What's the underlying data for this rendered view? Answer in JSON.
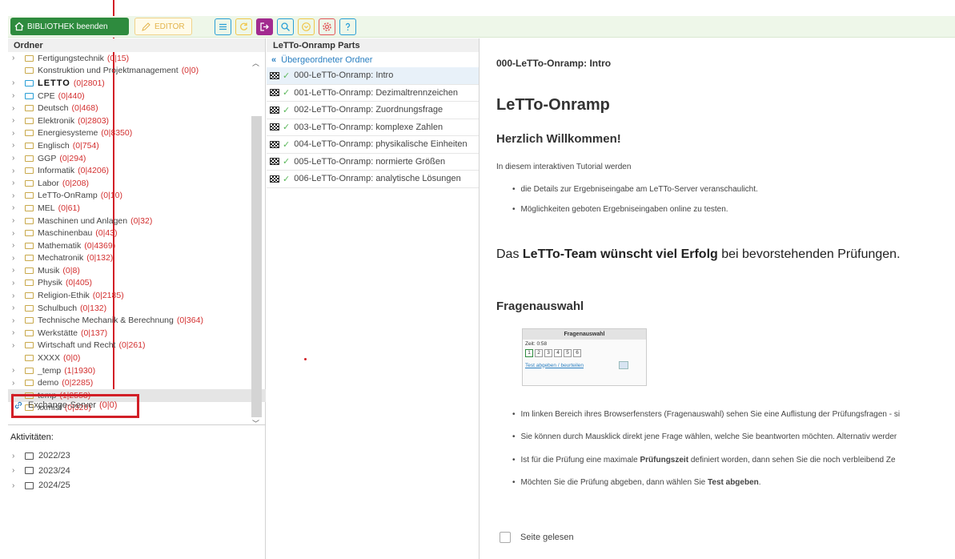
{
  "toolbar": {
    "exit_label": "BIBLIOTHEK beenden",
    "editor_label": "EDITOR",
    "icons": [
      "list-icon",
      "refresh-icon",
      "exit-icon",
      "search-icon",
      "chevron-down-icon",
      "settings-icon",
      "help-icon"
    ]
  },
  "folders_panel": {
    "title": "Ordner",
    "items": [
      {
        "label": "Fertigungstechnik",
        "count": "(0|15)",
        "chevron": true
      },
      {
        "label": "Konstruktion und Projektmanagement",
        "count": "(0|0)",
        "chevron": false
      },
      {
        "label": "LETTO",
        "count": "(0|2801)",
        "chevron": true,
        "open": true,
        "logo": true
      },
      {
        "label": "CPE",
        "count": "(0|440)",
        "chevron": true,
        "open": true
      },
      {
        "label": "Deutsch",
        "count": "(0|468)",
        "chevron": true
      },
      {
        "label": "Elektronik",
        "count": "(0|2803)",
        "chevron": true
      },
      {
        "label": "Energiesysteme",
        "count": "(0|8350)",
        "chevron": true
      },
      {
        "label": "Englisch",
        "count": "(0|754)",
        "chevron": true
      },
      {
        "label": "GGP",
        "count": "(0|294)",
        "chevron": true
      },
      {
        "label": "Informatik",
        "count": "(0|4206)",
        "chevron": true
      },
      {
        "label": "Labor",
        "count": "(0|208)",
        "chevron": true
      },
      {
        "label": "LeTTo-OnRamp",
        "count": "(0|10)",
        "chevron": true
      },
      {
        "label": "MEL",
        "count": "(0|61)",
        "chevron": true
      },
      {
        "label": "Maschinen und Anlagen",
        "count": "(0|32)",
        "chevron": true
      },
      {
        "label": "Maschinenbau",
        "count": "(0|43)",
        "chevron": true
      },
      {
        "label": "Mathematik",
        "count": "(0|4369)",
        "chevron": true
      },
      {
        "label": "Mechatronik",
        "count": "(0|132)",
        "chevron": true
      },
      {
        "label": "Musik",
        "count": "(0|8)",
        "chevron": true
      },
      {
        "label": "Physik",
        "count": "(0|405)",
        "chevron": true
      },
      {
        "label": "Religion-Ethik",
        "count": "(0|2185)",
        "chevron": true
      },
      {
        "label": "Schulbuch",
        "count": "(0|132)",
        "chevron": true
      },
      {
        "label": "Technische Mechanik & Berechnung",
        "count": "(0|364)",
        "chevron": true
      },
      {
        "label": "Werkstätte",
        "count": "(0|137)",
        "chevron": true
      },
      {
        "label": "Wirtschaft und Recht",
        "count": "(0|261)",
        "chevron": true
      },
      {
        "label": "XXXX",
        "count": "(0|0)",
        "chevron": false
      },
      {
        "label": "_temp",
        "count": "(1|1930)",
        "chevron": true
      },
      {
        "label": "demo",
        "count": "(0|2285)",
        "chevron": true
      },
      {
        "label": "temp",
        "count": "(1|2553)",
        "chevron": true,
        "selected": true
      },
      {
        "label": "xxmist",
        "count": "(0|320)",
        "chevron": false
      }
    ],
    "exchange": {
      "label": "Exchange-Server",
      "count": "(0|0)"
    }
  },
  "activities": {
    "title": "Aktivitäten:",
    "items": [
      "2022/23",
      "2023/24",
      "2024/25"
    ]
  },
  "parts_panel": {
    "title": "LeTTo-Onramp Parts",
    "parent_label": "Übergeordneter Ordner",
    "items": [
      "000-LeTTo-Onramp: Intro",
      "001-LeTTo-Onramp: Dezimaltrennzeichen",
      "002-LeTTo-Onramp: Zuordnungsfrage",
      "003-LeTTo-Onramp: komplexe Zahlen",
      "004-LeTTo-Onramp: physikalische Einheiten",
      "005-LeTTo-Onramp: normierte Größen",
      "006-LeTTo-Onramp: analytische Lösungen"
    ]
  },
  "content": {
    "breadcrumb": "000-LeTTo-Onramp: Intro",
    "h1": "LeTTo-Onramp",
    "h2": "Herzlich Willkommen!",
    "intro": "In diesem interaktiven Tutorial werden",
    "bullets1": [
      "die Details zur Ergebniseingabe am LeTTo-Server veranschaulicht.",
      "Möglichkeiten geboten Ergebniseingaben online zu testen."
    ],
    "big_pre": "Das ",
    "big_bold1": "LeTTo-Team wünscht viel Erfolg",
    "big_post": " bei bevorstehenden Prüfungen.",
    "h3": "Fragenauswahl",
    "mini": {
      "title": "Fragenauswahl",
      "time": "Zeit: 0:58",
      "nums": [
        "1",
        "2",
        "3",
        "4",
        "5",
        "6"
      ],
      "link": "Test abgeben / beurteilen"
    },
    "bullets2": [
      {
        "pre": "Im linken Bereich ihres Browserfensters (Fragenauswahl) sehen Sie eine Auflistung der Prüfungsfragen - si",
        "bold": "",
        "post": ""
      },
      {
        "pre": "Sie können durch Mausklick direkt jene Frage wählen, welche Sie beantworten möchten. Alternativ werder",
        "bold": "",
        "post": ""
      },
      {
        "pre": "Ist für die Prüfung eine maximale ",
        "bold": "Prüfungszeit",
        "post": " definiert worden, dann sehen Sie die noch verbleibend Ze"
      },
      {
        "pre": "Möchten Sie die Prüfung abgeben, dann wählen Sie ",
        "bold": "Test abgeben",
        "post": "."
      }
    ],
    "checkbox_label": "Seite gelesen"
  }
}
